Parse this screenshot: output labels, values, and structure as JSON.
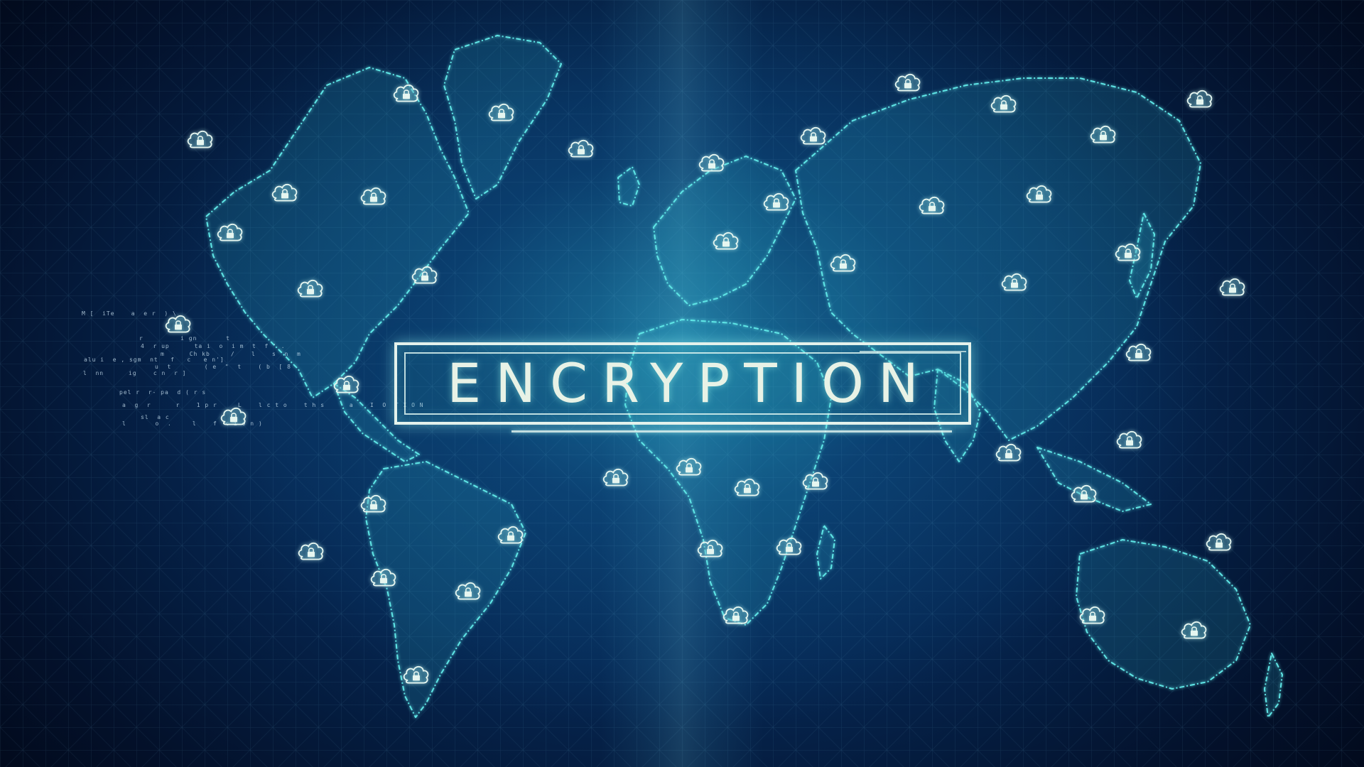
{
  "title": "ENCRYPTION",
  "colors": {
    "background_dark": "#020a1c",
    "background_mid": "#0b3f74",
    "glow_cyan": "#3fc8d0",
    "map_outline": "#5fe6e6",
    "text": "#e8f2e6"
  },
  "icons": {
    "cloud": "cloud-lock-icon",
    "lock": "padlock-icon"
  },
  "code_fragments": [
    "M [  iTe    a  e r  ) \\",
    "r         i gn       t",
    "4  r up      ta i  o  i m  t  f ' .",
    "m      Ch kb     /    l    s  n  m",
    "alu i  e , sgm  nt   f   c   e n']",
    "u  t        ( e  \"  t    ( b  [ 8",
    "l  nn      ig    c n  r ]",
    "pel r  r- pa  d ( r s",
    "a  g  r      r    1 p r     L    l c t o    t h s      a    I  O  T I O N",
    "sl  a c",
    "l       o  .     l    f  c i o n )"
  ]
}
